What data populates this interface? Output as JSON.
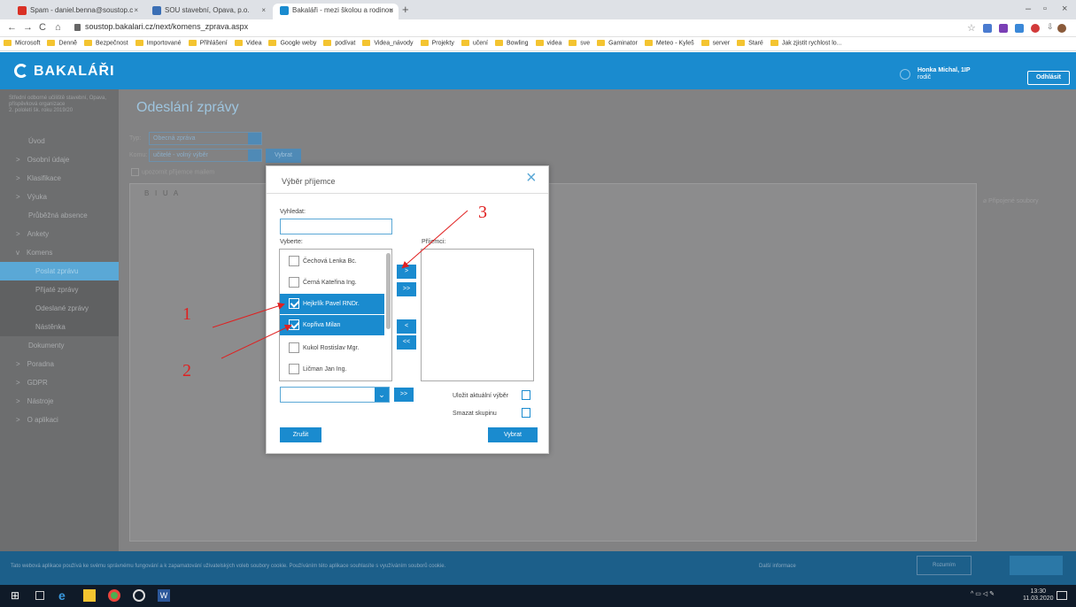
{
  "browser": {
    "tabs": [
      {
        "title": "Spam - daniel.benna@soustop.c",
        "icon_color": "#d93025"
      },
      {
        "title": "SOU stavební, Opava, p.o.",
        "icon_color": "#3b6fb5"
      },
      {
        "title": "Bakaláři - mezi školou a rodinou",
        "icon_color": "#1a8bcf"
      }
    ],
    "url": "soustop.bakalari.cz/next/komens_zprava.aspx",
    "bookmarks": [
      "Microsoft",
      "Denně",
      "Bezpečnost",
      "Importované",
      "Přihlášení",
      "Videa",
      "Google weby",
      "podívat",
      "Videa_návody",
      "Projekty",
      "učení",
      "Bowling",
      "videa",
      "sve",
      "Gaminator",
      "Meteo - Kyleš",
      "server",
      "Staré",
      "Jak zjistit rychlost lo..."
    ]
  },
  "header": {
    "brand": "BAKALÁŘI",
    "user_name": "Honka Michal, 1IP",
    "user_role": "rodič",
    "logout": "Odhlásit"
  },
  "sidebar": {
    "school": "Střední odborné učiliště stavební, Opava, příspěvková organizace",
    "school_sub": "2. pololetí šk. roku 2019/20",
    "items": [
      "Úvod",
      "Osobní údaje",
      "Klasifikace",
      "Výuka",
      "Průběžná absence",
      "Ankety",
      "Komens",
      "Poslat zprávu",
      "Přijaté zprávy",
      "Odeslané zprávy",
      "Nástěnka",
      "Dokumenty",
      "Poradna",
      "GDPR",
      "Nástroje",
      "O aplikaci"
    ]
  },
  "main": {
    "title": "Odeslání zprávy",
    "type_label": "Typ:",
    "type_value": "Obecná zpráva",
    "to_label": "Komu:",
    "to_value": "učitelé - volný výběr",
    "choose_btn": "Vybrat",
    "notify_label": "upozornit příjemce mailem",
    "attach": "Připojené soubory"
  },
  "modal": {
    "title": "Výběr příjemce",
    "search_label": "Vyhledat:",
    "select_label": "Vyberte:",
    "recipients_label": "Příjemci:",
    "people": [
      {
        "name": "Čechová Lenka Bc.",
        "checked": false
      },
      {
        "name": "Černá Kateřina Ing.",
        "checked": false
      },
      {
        "name": "Hejkrlík Pavel RNDr.",
        "checked": true
      },
      {
        "name": "Kopřiva Milan",
        "checked": true
      },
      {
        "name": "Kukol Rostislav Mgr.",
        "checked": false
      },
      {
        "name": "Ličman Jan Ing.",
        "checked": false
      }
    ],
    "move_right": ">",
    "move_all_right": ">>",
    "move_left": "<",
    "move_all_left": "<<",
    "save_selection": "Uložit aktuální výběr",
    "delete_group": "Smazat skupinu",
    "cancel": "Zrušit",
    "confirm": "Vybrat"
  },
  "annotations": [
    "1",
    "2",
    "3"
  ],
  "cookie": {
    "text": "Tato webová aplikace používá ke svému správnému fungování a k zapamatování uživatelských voleb soubory cookie. Používáním této aplikace souhlasíte s využíváním souborů cookie.",
    "more": "Další informace",
    "ok": "Rozumím"
  },
  "taskbar": {
    "time": "13:30",
    "date": "11.03.2020"
  }
}
